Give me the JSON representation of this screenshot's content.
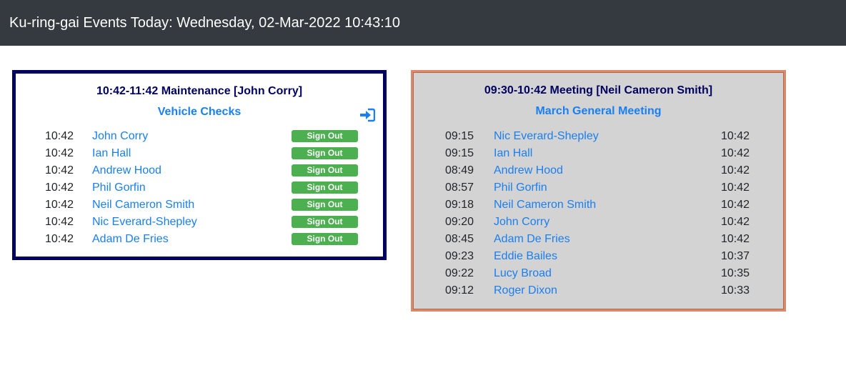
{
  "header": {
    "title": "Ku-ring-gai Events Today: Wednesday, 02-Mar-2022 10:43:10"
  },
  "event_a": {
    "title": "10:42-11:42 Maintenance [John Corry]",
    "subtitle": "Vehicle Checks",
    "icon": "sign-in-icon",
    "rows": [
      {
        "time": "10:42",
        "name": "John Corry",
        "action": "Sign Out"
      },
      {
        "time": "10:42",
        "name": "Ian Hall",
        "action": "Sign Out"
      },
      {
        "time": "10:42",
        "name": "Andrew Hood",
        "action": "Sign Out"
      },
      {
        "time": "10:42",
        "name": "Phil Gorfin",
        "action": "Sign Out"
      },
      {
        "time": "10:42",
        "name": "Neil Cameron Smith",
        "action": "Sign Out"
      },
      {
        "time": "10:42",
        "name": "Nic Everard-Shepley",
        "action": "Sign Out"
      },
      {
        "time": "10:42",
        "name": "Adam De Fries",
        "action": "Sign Out"
      }
    ]
  },
  "event_b": {
    "title": "09:30-10:42 Meeting [Neil Cameron Smith]",
    "subtitle": "March General Meeting",
    "rows": [
      {
        "in": "09:15",
        "name": "Nic Everard-Shepley",
        "out": "10:42"
      },
      {
        "in": "09:15",
        "name": "Ian Hall",
        "out": "10:42"
      },
      {
        "in": "08:49",
        "name": "Andrew Hood",
        "out": "10:42"
      },
      {
        "in": "08:57",
        "name": "Phil Gorfin",
        "out": "10:42"
      },
      {
        "in": "09:18",
        "name": "Neil Cameron Smith",
        "out": "10:42"
      },
      {
        "in": "09:20",
        "name": "John Corry",
        "out": "10:42"
      },
      {
        "in": "08:45",
        "name": "Adam De Fries",
        "out": "10:42"
      },
      {
        "in": "09:23",
        "name": "Eddie Bailes",
        "out": "10:37"
      },
      {
        "in": "09:22",
        "name": "Lucy Broad",
        "out": "10:35"
      },
      {
        "in": "09:12",
        "name": "Roger Dixon",
        "out": "10:33"
      }
    ]
  },
  "colors": {
    "header_bg": "#343a40",
    "accent_blue": "#1a7ff0",
    "panel_a_border": "#000060",
    "panel_b_border": "#d98a6c",
    "signout_green": "#4caf50"
  }
}
